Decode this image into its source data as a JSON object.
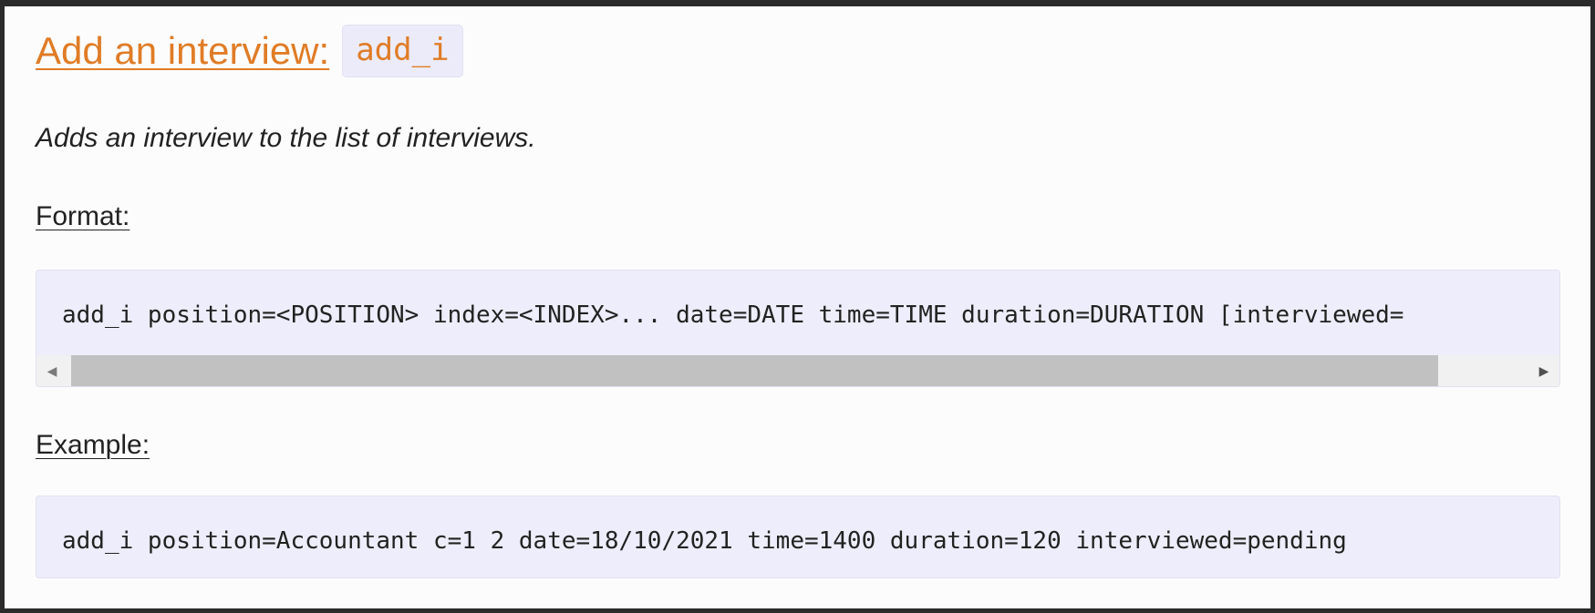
{
  "section": {
    "heading_link": "Add an interview:",
    "heading_code": "add_i",
    "description": "Adds an interview to the list of interviews."
  },
  "format": {
    "label": "Format:",
    "code": "add_i position=<POSITION> index=<INDEX>... date=DATE time=TIME duration=DURATION [interviewed=",
    "scroll_left_icon": "◀",
    "scroll_right_icon": "▶"
  },
  "example": {
    "label": "Example:",
    "code": "add_i position=Accountant c=1 2 date=18/10/2021 time=1400 duration=120 interviewed=pending"
  },
  "colors": {
    "link": "#e07c26",
    "code_background": "#ededfb",
    "page_background": "#fcfcfd"
  }
}
